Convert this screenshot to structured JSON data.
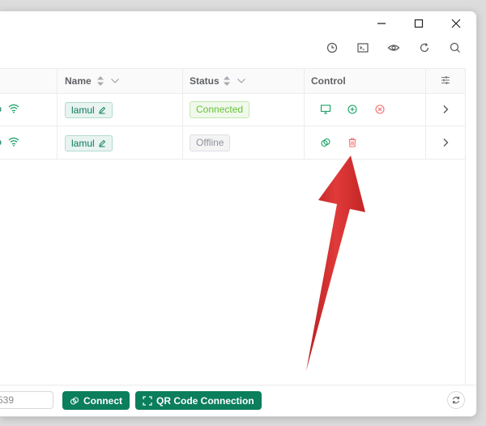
{
  "table": {
    "columns": {
      "name": "Name",
      "status": "Status",
      "control": "Control"
    },
    "rows": [
      {
        "name": "lamul",
        "status": "Connected"
      },
      {
        "name": "lamul",
        "status": "Offline"
      }
    ]
  },
  "footer": {
    "address_value": "539",
    "connect_label": "Connect",
    "qr_label": "QR Code Connection"
  },
  "colors": {
    "accent": "#0b7e5c",
    "connected": "#67c23a",
    "offline": "#909399",
    "danger": "#f56c6c",
    "annotation_arrow": "#d42a2a"
  },
  "icons": {
    "titlebar": [
      "minimize-icon",
      "maximize-icon",
      "close-icon"
    ],
    "toolbar": [
      "clock-icon",
      "terminal-icon",
      "eye-icon",
      "refresh-icon",
      "search-icon"
    ],
    "row1_controls": [
      "monitor-icon",
      "plus-circle-icon",
      "x-circle-icon"
    ],
    "row2_controls": [
      "copy-icon",
      "trash-icon"
    ]
  }
}
